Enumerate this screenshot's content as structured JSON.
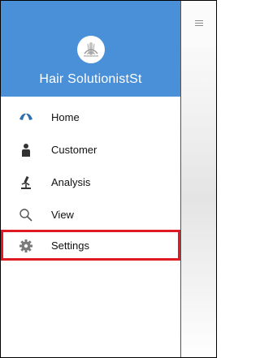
{
  "app": {
    "title": "Hair SolutionistSt"
  },
  "drawer": {
    "items": [
      {
        "label": "Home",
        "icon": "home-icon"
      },
      {
        "label": "Customer",
        "icon": "person-icon"
      },
      {
        "label": "Analysis",
        "icon": "microscope-icon"
      },
      {
        "label": "View",
        "icon": "search-icon"
      },
      {
        "label": "Settings",
        "icon": "gear-icon",
        "selected": true
      }
    ]
  },
  "colors": {
    "header": "#4a90d9",
    "highlight": "#e01a22",
    "home_icon": "#2f6fb0"
  }
}
